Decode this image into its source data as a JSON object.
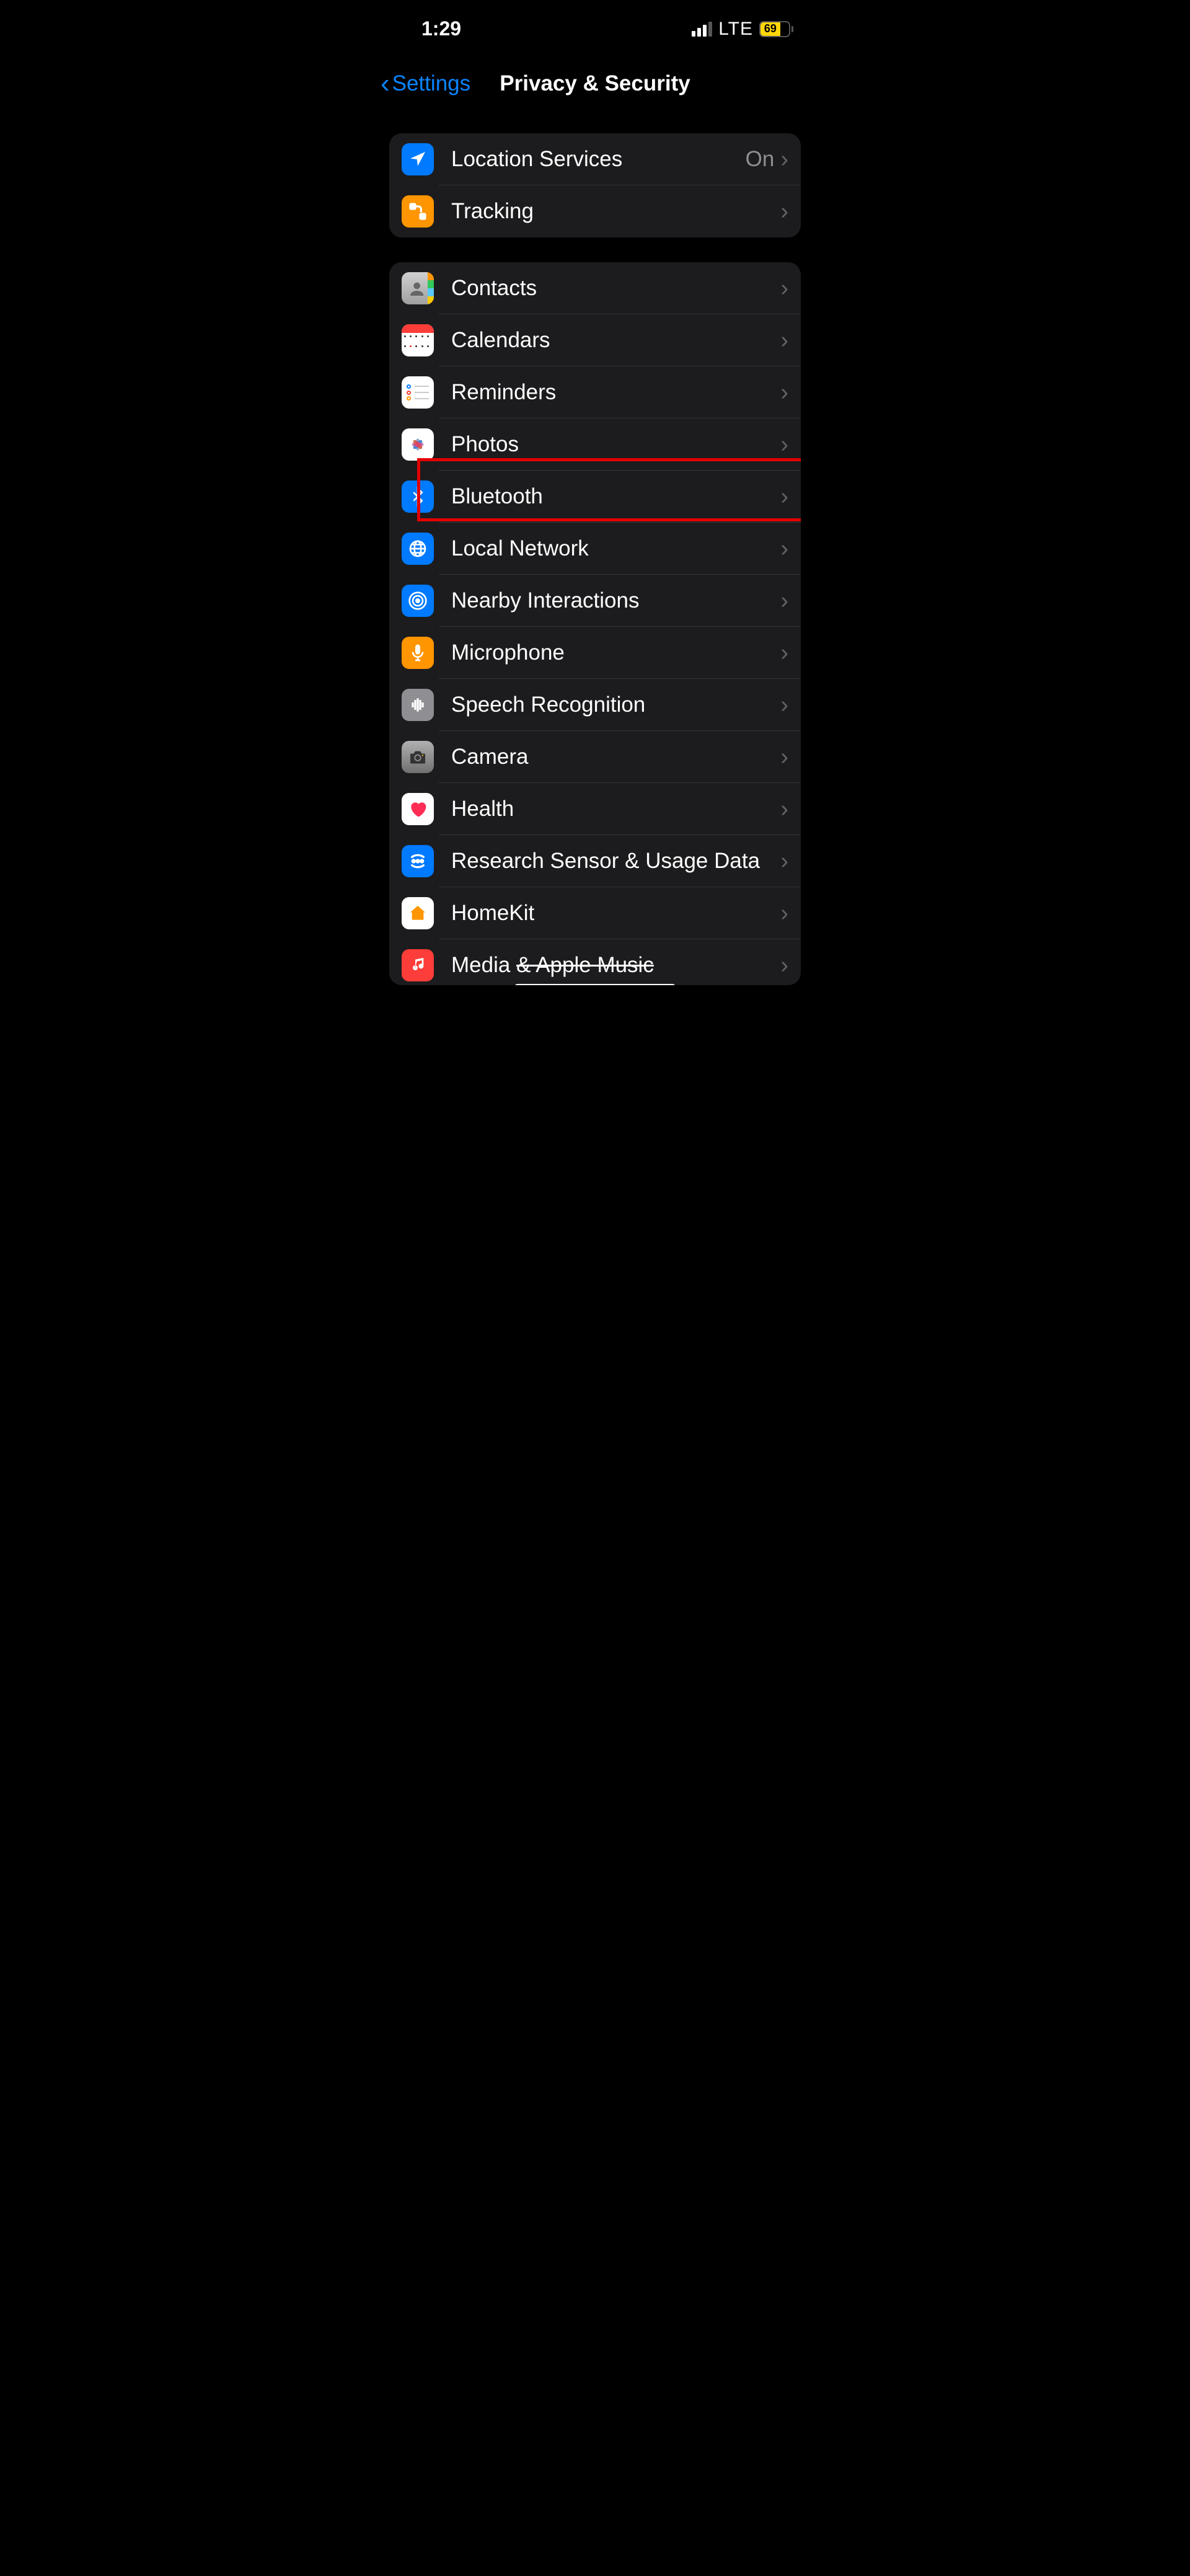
{
  "status": {
    "time": "1:29",
    "carrier": "LTE",
    "battery": "69"
  },
  "nav": {
    "back": "Settings",
    "title": "Privacy & Security"
  },
  "group1": {
    "items": [
      {
        "label": "Location Services",
        "value": "On"
      },
      {
        "label": "Tracking"
      }
    ]
  },
  "group2": {
    "items": [
      {
        "label": "Contacts"
      },
      {
        "label": "Calendars"
      },
      {
        "label": "Reminders"
      },
      {
        "label": "Photos"
      },
      {
        "label": "Bluetooth"
      },
      {
        "label": "Local Network"
      },
      {
        "label": "Nearby Interactions"
      },
      {
        "label": "Microphone"
      },
      {
        "label": "Speech Recognition"
      },
      {
        "label": "Camera"
      },
      {
        "label": "Health"
      },
      {
        "label": "Research Sensor & Usage Data"
      },
      {
        "label": "HomeKit"
      },
      {
        "label_pre": "Media ",
        "label_strike": "& Apple Music"
      }
    ]
  }
}
